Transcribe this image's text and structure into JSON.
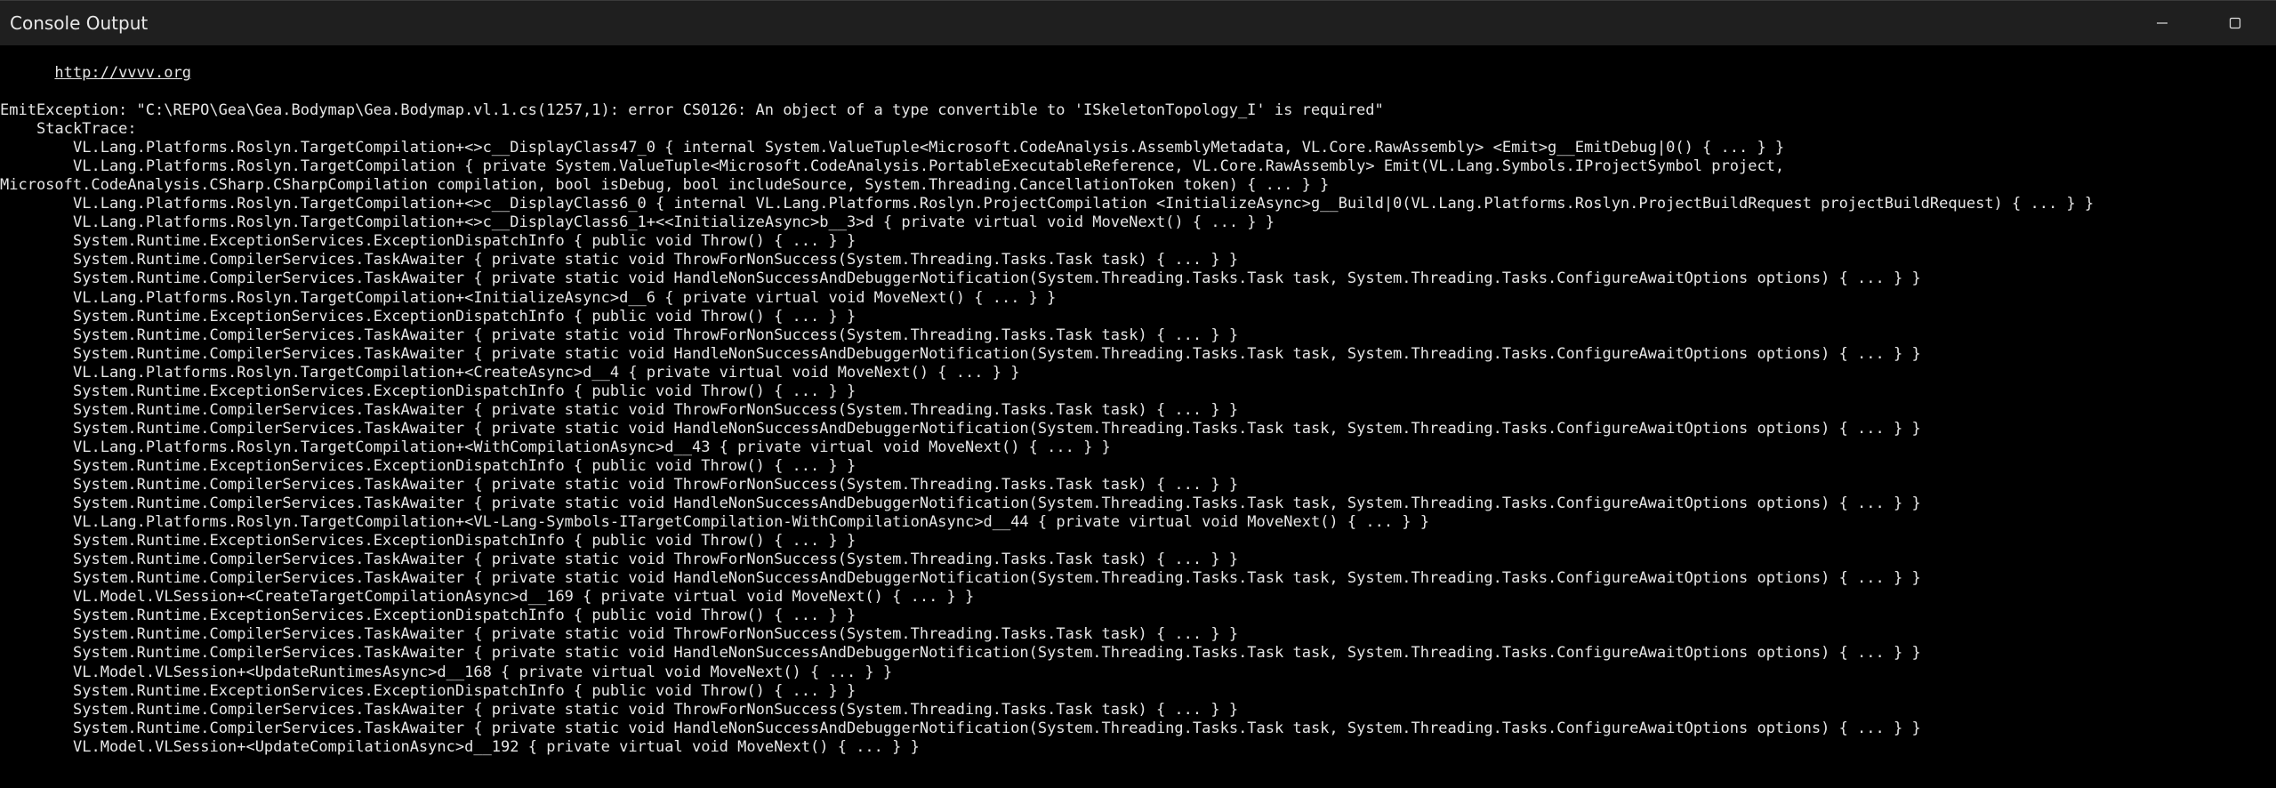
{
  "window": {
    "title": "Console Output",
    "minimize_icon": "minimize-icon",
    "maximize_icon": "maximize-icon"
  },
  "console": {
    "link": "http://vvvv.org",
    "lines": [
      {
        "indent": 0,
        "text": "EmitException: \"C:\\REPO\\Gea\\Gea.Bodymap\\Gea.Bodymap.vl.1.cs(1257,1): error CS0126: An object of a type convertible to 'ISkeletonTopology_I' is required\""
      },
      {
        "indent": 4,
        "text": "StackTrace:"
      },
      {
        "indent": 8,
        "text": "VL.Lang.Platforms.Roslyn.TargetCompilation+<>c__DisplayClass47_0 { internal System.ValueTuple<Microsoft.CodeAnalysis.AssemblyMetadata, VL.Core.RawAssembly> <Emit>g__EmitDebug|0() { ... } }"
      },
      {
        "indent": 8,
        "text": "VL.Lang.Platforms.Roslyn.TargetCompilation { private System.ValueTuple<Microsoft.CodeAnalysis.PortableExecutableReference, VL.Core.RawAssembly> Emit(VL.Lang.Symbols.IProjectSymbol project,"
      },
      {
        "indent": 0,
        "text": "Microsoft.CodeAnalysis.CSharp.CSharpCompilation compilation, bool isDebug, bool includeSource, System.Threading.CancellationToken token) { ... } }"
      },
      {
        "indent": 8,
        "text": "VL.Lang.Platforms.Roslyn.TargetCompilation+<>c__DisplayClass6_0 { internal VL.Lang.Platforms.Roslyn.ProjectCompilation <InitializeAsync>g__Build|0(VL.Lang.Platforms.Roslyn.ProjectBuildRequest projectBuildRequest) { ... } }"
      },
      {
        "indent": 8,
        "text": "VL.Lang.Platforms.Roslyn.TargetCompilation+<>c__DisplayClass6_1+<<InitializeAsync>b__3>d { private virtual void MoveNext() { ... } }"
      },
      {
        "indent": 8,
        "text": "System.Runtime.ExceptionServices.ExceptionDispatchInfo { public void Throw() { ... } }"
      },
      {
        "indent": 8,
        "text": "System.Runtime.CompilerServices.TaskAwaiter { private static void ThrowForNonSuccess(System.Threading.Tasks.Task task) { ... } }"
      },
      {
        "indent": 8,
        "text": "System.Runtime.CompilerServices.TaskAwaiter { private static void HandleNonSuccessAndDebuggerNotification(System.Threading.Tasks.Task task, System.Threading.Tasks.ConfigureAwaitOptions options) { ... } }"
      },
      {
        "indent": 8,
        "text": "VL.Lang.Platforms.Roslyn.TargetCompilation+<InitializeAsync>d__6 { private virtual void MoveNext() { ... } }"
      },
      {
        "indent": 8,
        "text": "System.Runtime.ExceptionServices.ExceptionDispatchInfo { public void Throw() { ... } }"
      },
      {
        "indent": 8,
        "text": "System.Runtime.CompilerServices.TaskAwaiter { private static void ThrowForNonSuccess(System.Threading.Tasks.Task task) { ... } }"
      },
      {
        "indent": 8,
        "text": "System.Runtime.CompilerServices.TaskAwaiter { private static void HandleNonSuccessAndDebuggerNotification(System.Threading.Tasks.Task task, System.Threading.Tasks.ConfigureAwaitOptions options) { ... } }"
      },
      {
        "indent": 8,
        "text": "VL.Lang.Platforms.Roslyn.TargetCompilation+<CreateAsync>d__4 { private virtual void MoveNext() { ... } }"
      },
      {
        "indent": 8,
        "text": "System.Runtime.ExceptionServices.ExceptionDispatchInfo { public void Throw() { ... } }"
      },
      {
        "indent": 8,
        "text": "System.Runtime.CompilerServices.TaskAwaiter { private static void ThrowForNonSuccess(System.Threading.Tasks.Task task) { ... } }"
      },
      {
        "indent": 8,
        "text": "System.Runtime.CompilerServices.TaskAwaiter { private static void HandleNonSuccessAndDebuggerNotification(System.Threading.Tasks.Task task, System.Threading.Tasks.ConfigureAwaitOptions options) { ... } }"
      },
      {
        "indent": 8,
        "text": "VL.Lang.Platforms.Roslyn.TargetCompilation+<WithCompilationAsync>d__43 { private virtual void MoveNext() { ... } }"
      },
      {
        "indent": 8,
        "text": "System.Runtime.ExceptionServices.ExceptionDispatchInfo { public void Throw() { ... } }"
      },
      {
        "indent": 8,
        "text": "System.Runtime.CompilerServices.TaskAwaiter { private static void ThrowForNonSuccess(System.Threading.Tasks.Task task) { ... } }"
      },
      {
        "indent": 8,
        "text": "System.Runtime.CompilerServices.TaskAwaiter { private static void HandleNonSuccessAndDebuggerNotification(System.Threading.Tasks.Task task, System.Threading.Tasks.ConfigureAwaitOptions options) { ... } }"
      },
      {
        "indent": 8,
        "text": "VL.Lang.Platforms.Roslyn.TargetCompilation+<VL-Lang-Symbols-ITargetCompilation-WithCompilationAsync>d__44 { private virtual void MoveNext() { ... } }"
      },
      {
        "indent": 8,
        "text": "System.Runtime.ExceptionServices.ExceptionDispatchInfo { public void Throw() { ... } }"
      },
      {
        "indent": 8,
        "text": "System.Runtime.CompilerServices.TaskAwaiter { private static void ThrowForNonSuccess(System.Threading.Tasks.Task task) { ... } }"
      },
      {
        "indent": 8,
        "text": "System.Runtime.CompilerServices.TaskAwaiter { private static void HandleNonSuccessAndDebuggerNotification(System.Threading.Tasks.Task task, System.Threading.Tasks.ConfigureAwaitOptions options) { ... } }"
      },
      {
        "indent": 8,
        "text": "VL.Model.VLSession+<CreateTargetCompilationAsync>d__169 { private virtual void MoveNext() { ... } }"
      },
      {
        "indent": 8,
        "text": "System.Runtime.ExceptionServices.ExceptionDispatchInfo { public void Throw() { ... } }"
      },
      {
        "indent": 8,
        "text": "System.Runtime.CompilerServices.TaskAwaiter { private static void ThrowForNonSuccess(System.Threading.Tasks.Task task) { ... } }"
      },
      {
        "indent": 8,
        "text": "System.Runtime.CompilerServices.TaskAwaiter { private static void HandleNonSuccessAndDebuggerNotification(System.Threading.Tasks.Task task, System.Threading.Tasks.ConfigureAwaitOptions options) { ... } }"
      },
      {
        "indent": 8,
        "text": "VL.Model.VLSession+<UpdateRuntimesAsync>d__168 { private virtual void MoveNext() { ... } }"
      },
      {
        "indent": 8,
        "text": "System.Runtime.ExceptionServices.ExceptionDispatchInfo { public void Throw() { ... } }"
      },
      {
        "indent": 8,
        "text": "System.Runtime.CompilerServices.TaskAwaiter { private static void ThrowForNonSuccess(System.Threading.Tasks.Task task) { ... } }"
      },
      {
        "indent": 8,
        "text": "System.Runtime.CompilerServices.TaskAwaiter { private static void HandleNonSuccessAndDebuggerNotification(System.Threading.Tasks.Task task, System.Threading.Tasks.ConfigureAwaitOptions options) { ... } }"
      },
      {
        "indent": 8,
        "text": "VL.Model.VLSession+<UpdateCompilationAsync>d__192 { private virtual void MoveNext() { ... } }"
      }
    ]
  }
}
